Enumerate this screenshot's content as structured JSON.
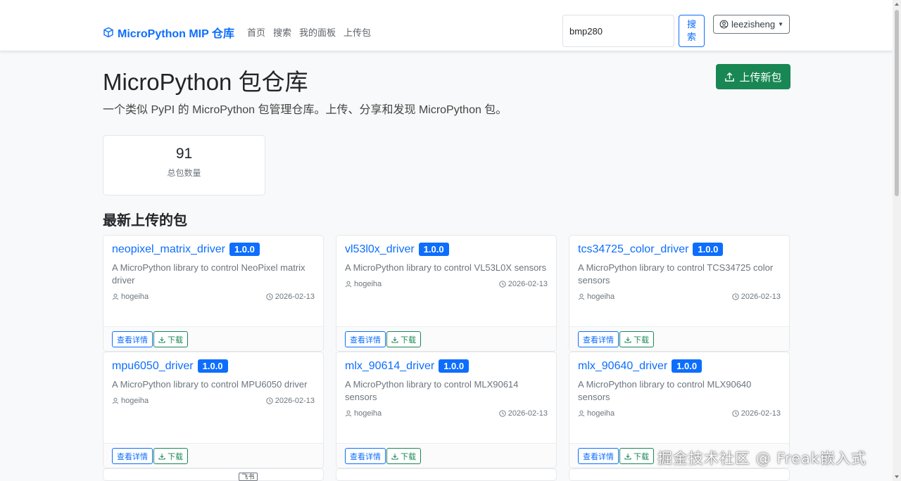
{
  "navbar": {
    "brand": "MicroPython MIP 仓库",
    "links": [
      "首页",
      "搜索",
      "我的面板",
      "上传包"
    ],
    "search_value": "bmp280",
    "search_button": "搜索",
    "user": "leezisheng"
  },
  "header": {
    "title": "MicroPython 包仓库",
    "upload_new": "上传新包",
    "lead": "一个类似 PyPI 的 MicroPython 包管理仓库。上传、分享和发现 MicroPython 包。"
  },
  "stats": {
    "total_value": "91",
    "total_label": "总包数量"
  },
  "section_title": "最新上传的包",
  "packages": [
    {
      "name": "neopixel_matrix_driver",
      "version": "1.0.0",
      "description": "A MicroPython library to control NeoPixel matrix driver",
      "author": "hogeiha",
      "date": "2026-02-13",
      "detail_label": "查看详情",
      "download_label": "下载"
    },
    {
      "name": "vl53l0x_driver",
      "version": "1.0.0",
      "description": "A MicroPython library to control VL53L0X sensors",
      "author": "hogeiha",
      "date": "2026-02-13",
      "detail_label": "查看详情",
      "download_label": "下载"
    },
    {
      "name": "tcs34725_color_driver",
      "version": "1.0.0",
      "description": "A MicroPython library to control TCS34725 color sensors",
      "author": "hogeiha",
      "date": "2026-02-13",
      "detail_label": "查看详情",
      "download_label": "下载"
    },
    {
      "name": "mpu6050_driver",
      "version": "1.0.0",
      "description": "A MicroPython library to control MPU6050 driver",
      "author": "hogeiha",
      "date": "2026-02-13",
      "detail_label": "查看详情",
      "download_label": "下载"
    },
    {
      "name": "mlx_90614_driver",
      "version": "1.0.0",
      "description": "A MicroPython library to control MLX90614 sensors",
      "author": "hogeiha",
      "date": "2026-02-13",
      "detail_label": "查看详情",
      "download_label": "下载"
    },
    {
      "name": "mlx_90640_driver",
      "version": "1.0.0",
      "description": "A MicroPython library to control MLX90640 sensors",
      "author": "hogeiha",
      "date": "2026-02-13",
      "detail_label": "查看详情",
      "download_label": "下载"
    }
  ],
  "overlay": {
    "feishu_tag": "飞书",
    "watermark": "掘金技术社区 @ Freak嵌入式"
  },
  "colors": {
    "primary": "#0d6efd",
    "success": "#198754",
    "muted": "#6c757d",
    "background": "#f8f9fa"
  }
}
